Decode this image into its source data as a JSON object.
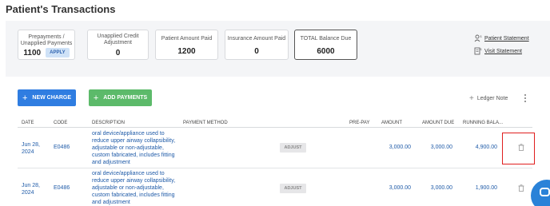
{
  "page": {
    "title": "Patient's Transactions"
  },
  "summary": {
    "prepayments_label": "Prepayments / Unapplied Payments",
    "prepayments_value": "1100",
    "apply_label": "APPLY",
    "unapplied_credit_label": "Unapplied Credit Adjustment",
    "unapplied_credit_value": "0",
    "patient_paid_label": "Patient Amount Paid",
    "patient_paid_value": "1200",
    "insurance_paid_label": "Insurance Amount Paid",
    "insurance_paid_value": "0",
    "total_due_label": "TOTAL Balance Due",
    "total_due_value": "6000"
  },
  "links": {
    "patient_statement": "Patient Statement",
    "visit_statement": "Visit Statement"
  },
  "toolbar": {
    "new_charge": "NEW CHARGE",
    "add_payments": "ADD PAYMENTS",
    "ledger_note": "Ledger Note"
  },
  "table": {
    "columns": [
      "DATE",
      "CODE",
      "DESCRIPTION",
      "PAYMENT METHOD",
      "PRE-PAY",
      "AMOUNT",
      "AMOUNT DUE",
      "RUNNING BALA..."
    ],
    "rows": [
      {
        "date": "Jun 28, 2024",
        "code": "E0486",
        "description": "oral device/appliance used to reduce upper airway collapsibility, adjustable or non-adjustable, custom fabricated, includes fitting and adjustment",
        "adjust": "ADJUST",
        "amount": "3,000.00",
        "amount_due": "3,000.00",
        "running_balance": "4,900.00"
      },
      {
        "date": "Jun 28, 2024",
        "code": "E0486",
        "description": "oral device/appliance used to reduce upper airway collapsibility, adjustable or non-adjustable, custom fabricated, includes fitting and adjustment",
        "adjust": "ADJUST",
        "amount": "3,000.00",
        "amount_due": "3,000.00",
        "running_balance": "1,900.00"
      }
    ]
  },
  "colors": {
    "primary": "#2f7de1",
    "success": "#5cba6a",
    "link": "#1f5ba8",
    "highlight": "#e01e1e"
  },
  "icons": [
    "plus-icon",
    "person-icon",
    "document-icon",
    "kebab-icon",
    "trash-icon",
    "chat-icon"
  ]
}
